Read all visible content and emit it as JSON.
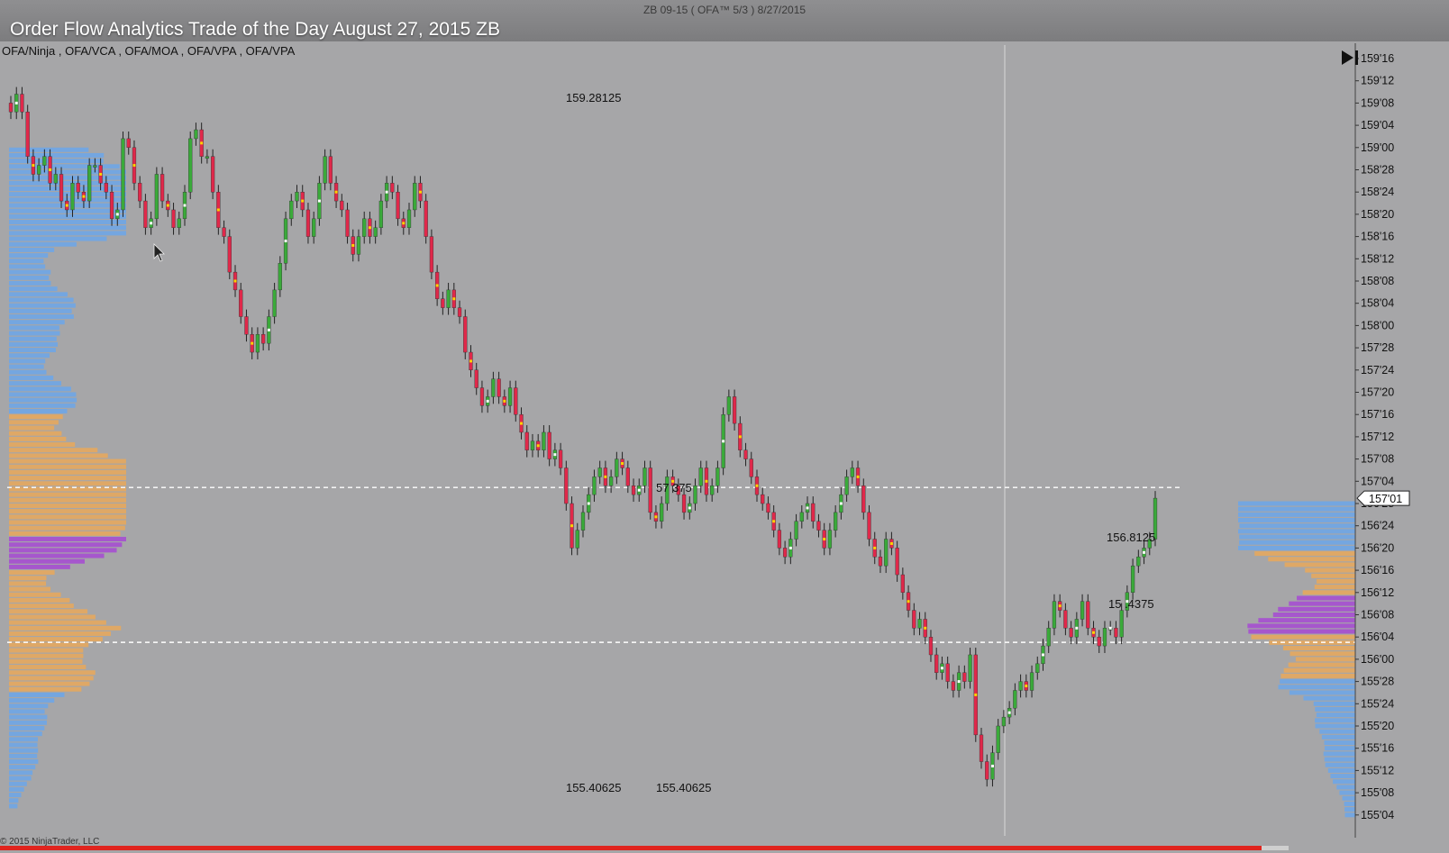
{
  "window": {
    "label": "ZB 09-15 ( OFA™ 5/3 )  8/27/2015",
    "video_title": "Order Flow Analytics Trade of the Day August 27, 2015 ZB",
    "indicators": "OFA/Ninja , OFA/VCA , OFA/MOA , OFA/VPA , OFA/VPA",
    "copyright": "© 2015 NinjaTrader, LLC"
  },
  "colors": {
    "up": "#3aaa3a",
    "down": "#e0284a",
    "profile_blue": "#6fa6e6",
    "profile_orange": "#e6a85e",
    "profile_purple": "#a64fd0",
    "progress": "#e0241e"
  },
  "icons": [
    "skip-to-end-icon",
    "mouse-cursor-icon"
  ],
  "chart_data": {
    "type": "candlestick",
    "symbol": "ZB 09-15",
    "price_axis": {
      "side": "right",
      "ticks": [
        "159'16",
        "159'12",
        "159'08",
        "159'04",
        "159'00",
        "158'28",
        "158'24",
        "158'20",
        "158'16",
        "158'12",
        "158'08",
        "158'04",
        "158'00",
        "157'28",
        "157'24",
        "157'20",
        "157'16",
        "157'12",
        "157'08",
        "157'04",
        "156'28",
        "156'24",
        "156'20",
        "156'16",
        "156'12",
        "156'08",
        "156'04",
        "156'00",
        "155'28",
        "155'24",
        "155'20",
        "155'16",
        "155'12",
        "155'08",
        "155'04"
      ],
      "range": [
        155.125,
        159.5
      ],
      "last_price_label": "157'01"
    },
    "annotations": [
      {
        "text": "159.28125",
        "price": 159.28125
      },
      {
        "text": "155.40625",
        "price": 155.40625
      },
      {
        "text": "155.40625",
        "price": 155.40625
      },
      {
        "text": "157.375",
        "price": 157.09,
        "partial": "57   375"
      },
      {
        "text": "156.8125",
        "price": 156.8125,
        "partial": "156.8125"
      },
      {
        "text": "156.4375",
        "price": 156.4375,
        "partial": "15 .4375"
      }
    ],
    "reference_lines": [
      157.09,
      156.22
    ],
    "closes": [
      159.2,
      159.3,
      159.2,
      158.95,
      158.85,
      158.9,
      158.95,
      158.8,
      158.85,
      158.7,
      158.65,
      158.8,
      158.75,
      158.7,
      158.9,
      158.9,
      158.8,
      158.75,
      158.6,
      158.65,
      159.05,
      159.0,
      158.8,
      158.7,
      158.55,
      158.6,
      158.85,
      158.7,
      158.65,
      158.55,
      158.6,
      158.75,
      159.05,
      159.1,
      158.95,
      158.95,
      158.75,
      158.55,
      158.5,
      158.3,
      158.2,
      158.05,
      157.95,
      157.85,
      157.95,
      157.9,
      158.05,
      158.2,
      158.35,
      158.6,
      158.7,
      158.75,
      158.65,
      158.5,
      158.6,
      158.8,
      158.95,
      158.8,
      158.7,
      158.65,
      158.5,
      158.4,
      158.5,
      158.6,
      158.5,
      158.55,
      158.7,
      158.8,
      158.75,
      158.6,
      158.55,
      158.65,
      158.8,
      158.7,
      158.5,
      158.3,
      158.15,
      158.1,
      158.2,
      158.1,
      158.05,
      157.85,
      157.75,
      157.65,
      157.55,
      157.6,
      157.7,
      157.6,
      157.55,
      157.65,
      157.5,
      157.4,
      157.3,
      157.35,
      157.3,
      157.4,
      157.25,
      157.3,
      157.2,
      157.0,
      156.75,
      156.85,
      156.95,
      157.05,
      157.15,
      157.2,
      157.1,
      157.15,
      157.25,
      157.2,
      157.1,
      157.05,
      157.1,
      157.2,
      156.95,
      156.9,
      157.0,
      157.15,
      157.1,
      157.05,
      156.95,
      157.0,
      157.1,
      157.2,
      157.05,
      157.1,
      157.2,
      157.5,
      157.6,
      157.45,
      157.3,
      157.25,
      157.15,
      157.05,
      157.0,
      156.95,
      156.85,
      156.75,
      156.7,
      156.8,
      156.9,
      156.95,
      157.0,
      156.9,
      156.85,
      156.75,
      156.85,
      156.95,
      157.05,
      157.15,
      157.2,
      157.1,
      156.95,
      156.8,
      156.7,
      156.65,
      156.8,
      156.75,
      156.6,
      156.5,
      156.4,
      156.3,
      156.35,
      156.25,
      156.15,
      156.05,
      156.1,
      156.0,
      155.95,
      156.05,
      156.0,
      156.15,
      155.7,
      155.55,
      155.45,
      155.6,
      155.75,
      155.8,
      155.85,
      155.95,
      156.0,
      155.95,
      156.05,
      156.1,
      156.2,
      156.3,
      156.45,
      156.4,
      156.3,
      156.25,
      156.35,
      156.45,
      156.3,
      156.25,
      156.2,
      156.3,
      156.3,
      156.25,
      156.4,
      156.5,
      156.65,
      156.7,
      156.75,
      156.8,
      157.03
    ]
  }
}
